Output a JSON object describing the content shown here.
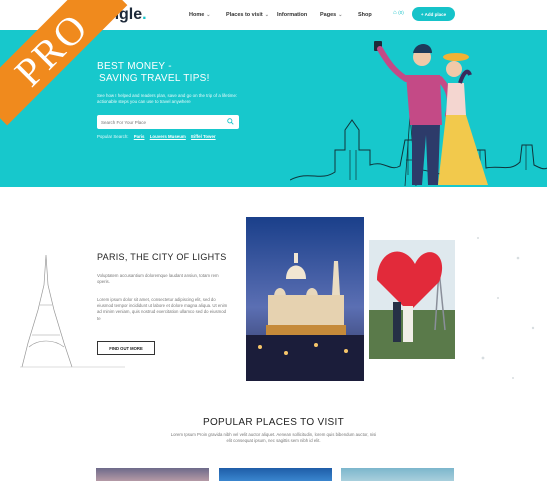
{
  "ribbon": {
    "label": "PRO"
  },
  "header": {
    "logo_text": "bingle",
    "logo_dot": ".",
    "nav": [
      {
        "label": "Home",
        "has_caret": true
      },
      {
        "label": "Places to visit",
        "has_caret": true
      },
      {
        "label": "Information",
        "has_caret": false
      },
      {
        "label": "Pages",
        "has_caret": true
      },
      {
        "label": "Shop",
        "has_caret": false
      }
    ],
    "cart_count": "(0)",
    "add_button": "+ Add place"
  },
  "hero": {
    "title_line1": "BEST MONEY -",
    "title_line2": "SAVING TRAVEL TIPS!",
    "description": "See how I helped and readers plan, save and go on the trip of a lifetime: actionable steps you can use to travel anywhere",
    "search_placeholder": "Search For Your Place",
    "popular_label": "Popular Search:",
    "popular_links": [
      "Paris",
      "Louvers Museum",
      "Eiffel Tower"
    ]
  },
  "paris": {
    "title": "PARIS, THE CITY OF LIGHTS",
    "paragraph1": "Voluptatem accusantium doloremque laudant ansiun, totam rem operis.",
    "paragraph2": "Lorem ipsum dolor sit amet, consectetur adipiscing elit, sed do eiusmod tempor incididunt ut labore et dolore magna aliqua. Ut enim ad minim veniam, quis nostrud exercitation ullamco sed do eiusmod te",
    "button": "FIND OUT MORE"
  },
  "popular_places": {
    "title": "POPULAR PLACES TO VISIT",
    "description": "Lorem Ipsum Proin gravida nibh vel velit auctor aliquet. Aenean sollicitudin, lorem quis bibendum auctor, nisi elit consequat ipsum, nec sagittis sem nibh id elit."
  },
  "colors": {
    "accent": "#17c8cc",
    "ribbon": "#f08a1d",
    "dark": "#1e2a3a"
  }
}
